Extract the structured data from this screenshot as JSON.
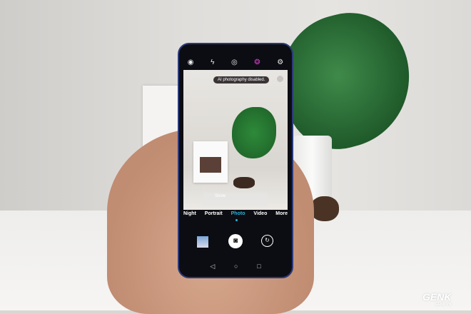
{
  "camera": {
    "top_icons": [
      "eye-icon",
      "flash-off-icon",
      "aperture-icon",
      "filter-icon",
      "gear-icon"
    ],
    "toast": "AI photography disabled.",
    "tip_title": "Snow",
    "modes": [
      "Night",
      "Portrait",
      "Photo",
      "Video",
      "More"
    ],
    "active_mode": "Photo",
    "accent": "#2ab3dc"
  },
  "watermark": {
    "brand": "GENK",
    "site": "GENK.VN"
  }
}
